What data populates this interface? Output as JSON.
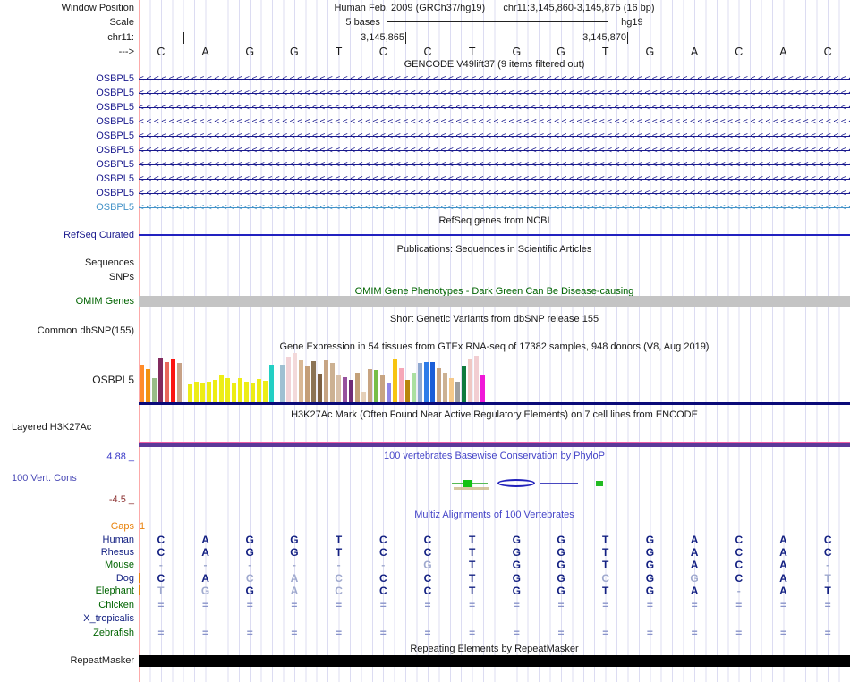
{
  "header": {
    "window_position_label": "Window Position",
    "assembly": "Human Feb. 2009 (GRCh37/hg19)",
    "position": "chr11:3,145,860-3,145,875 (16 bp)",
    "scale_label": "Scale",
    "scale_bases": "5 bases",
    "scale_assembly": "hg19",
    "chrom_label": "chr11:",
    "coord_left": "3,145,865",
    "coord_right": "3,145,870",
    "strand_label": "--->"
  },
  "base_track": {
    "bases": [
      "C",
      "A",
      "G",
      "G",
      "T",
      "C",
      "C",
      "T",
      "G",
      "G",
      "T",
      "G",
      "A",
      "C",
      "A",
      "C"
    ]
  },
  "gencode": {
    "title": "GENCODE V49lift37 (9 items filtered out)",
    "genes": [
      {
        "label": "OSBPL5",
        "color": "#1a1a8e"
      },
      {
        "label": "OSBPL5",
        "color": "#1a1a8e"
      },
      {
        "label": "OSBPL5",
        "color": "#1a1a8e"
      },
      {
        "label": "OSBPL5",
        "color": "#1a1a8e"
      },
      {
        "label": "OSBPL5",
        "color": "#1a1a8e"
      },
      {
        "label": "OSBPL5",
        "color": "#1a1a8e"
      },
      {
        "label": "OSBPL5",
        "color": "#1a1a8e"
      },
      {
        "label": "OSBPL5",
        "color": "#1a1a8e"
      },
      {
        "label": "OSBPL5",
        "color": "#1a1a8e"
      },
      {
        "label": "OSBPL5",
        "color": "#4493c8"
      }
    ]
  },
  "refseq": {
    "title": "RefSeq genes from NCBI",
    "label": "RefSeq Curated"
  },
  "publications": {
    "title": "Publications: Sequences in Scientific Articles",
    "sequences_label": "Sequences",
    "snps_label": "SNPs"
  },
  "omim": {
    "title": "OMIM Gene Phenotypes - Dark Green Can Be Disease-causing",
    "label": "OMIM Genes",
    "bar_color": "#c4c4c4"
  },
  "dbsnp": {
    "title": "Short Genetic Variants from dbSNP release 155",
    "label": "Common dbSNP(155)"
  },
  "gtex": {
    "title": "Gene Expression in 54 tissues from GTEx RNA-seq of 17382 samples, 948 donors (V8, Aug 2019)",
    "gene_label": "OSBPL5",
    "chart_data": {
      "type": "bar",
      "bars": [
        [
          "#FF8C2B",
          42
        ],
        [
          "#F2920F",
          37
        ],
        [
          "#99BD88",
          27
        ],
        [
          "#822B5F",
          49
        ],
        [
          "#E8685C",
          45
        ],
        [
          "#FB1410",
          48
        ],
        [
          "#C7A287",
          44
        ],
        [
          "#EDED16",
          20
        ],
        [
          "#EDED16",
          23
        ],
        [
          "#EDED16",
          22
        ],
        [
          "#EDED16",
          23
        ],
        [
          "#EDED16",
          25
        ],
        [
          "#EDED16",
          30
        ],
        [
          "#EDED16",
          27
        ],
        [
          "#EDED16",
          22
        ],
        [
          "#EDED16",
          27
        ],
        [
          "#EDED16",
          23
        ],
        [
          "#EDED16",
          21
        ],
        [
          "#EDED16",
          26
        ],
        [
          "#EDED16",
          24
        ],
        [
          "#23CFC4",
          42
        ],
        [
          "#9FC0D2",
          42
        ],
        [
          "#F2D2D6",
          51
        ],
        [
          "#F3D9DA",
          55
        ],
        [
          "#D9B895",
          47
        ],
        [
          "#C49E77",
          40
        ],
        [
          "#8B7355",
          46
        ],
        [
          "#7E6143",
          32
        ],
        [
          "#C7A584",
          47
        ],
        [
          "#CCB192",
          44
        ],
        [
          "#D8C0A8",
          30
        ],
        [
          "#96519E",
          28
        ],
        [
          "#6F2C77",
          25
        ],
        [
          "#C4A179",
          33
        ],
        [
          "#E5D0B9",
          12
        ],
        [
          "#C7A482",
          37
        ],
        [
          "#76BE48",
          36
        ],
        [
          "#C7A482",
          30
        ],
        [
          "#8F86E8",
          22
        ],
        [
          "#F7C411",
          48
        ],
        [
          "#F6A7B8",
          38
        ],
        [
          "#B8860B",
          25
        ],
        [
          "#ABE0A0",
          33
        ],
        [
          "#8FA8D0",
          44
        ],
        [
          "#2E7CE8",
          45
        ],
        [
          "#1B5ED8",
          45
        ],
        [
          "#C7A482",
          38
        ],
        [
          "#CCB192",
          33
        ],
        [
          "#F5C98A",
          27
        ],
        [
          "#9E9E9E",
          23
        ],
        [
          "#0F7A3D",
          40
        ],
        [
          "#EFC8C4",
          48
        ],
        [
          "#F2CED2",
          52
        ],
        [
          "#F018D8",
          30
        ]
      ]
    }
  },
  "h3k27ac": {
    "title": "H3K27Ac Mark (Often Found Near Active Regulatory Elements) on 7 cell lines from ENCODE",
    "label": "Layered H3K27Ac",
    "band_color": "#5c3999",
    "band_top_color": "#ee5fa5"
  },
  "conservation": {
    "title": "100 vertebrates Basewise Conservation by PhyloP",
    "label": "100 Vert. Cons",
    "max_label": "4.88 _",
    "min_label": "-4.5 _"
  },
  "multiz": {
    "title": "Multiz Alignments of 100 Vertebrates",
    "rows": [
      {
        "label": "Gaps",
        "label_color": "#e8820c",
        "marker": "1",
        "seq": "",
        "mask": ""
      },
      {
        "label": "Human",
        "label_color": "#132082",
        "seq": "CAGGTCCTGGTGACAC",
        "mask": "0000000000000000"
      },
      {
        "label": "Rhesus",
        "label_color": "#132082",
        "seq": "CAGGTCCTGGTGACAC",
        "mask": "0000000000000000"
      },
      {
        "label": "Mouse",
        "label_color": "#006400",
        "seq": "------GTGGTGACA-",
        "mask": "1111111000000001"
      },
      {
        "label": "Dog",
        "label_color": "#132082",
        "tick": true,
        "seq": "CACACCCTGGCGGCAT",
        "mask": "0011100000101001"
      },
      {
        "label": "Elephant",
        "label_color": "#006400",
        "tick": true,
        "seq": "TGGACCCTGGTGA-AT",
        "mask": "1101100000000100"
      },
      {
        "label": "Chicken",
        "label_color": "#006400",
        "seq": "================",
        "mask": "1111111111111111"
      },
      {
        "label": "X_tropicalis",
        "label_color": "#132082",
        "seq": "",
        "mask": ""
      },
      {
        "label": "Zebrafish",
        "label_color": "#006400",
        "seq": "================",
        "mask": "1111111111111111"
      }
    ]
  },
  "repeatmasker": {
    "title": "Repeating Elements by RepeatMasker",
    "label": "RepeatMasker",
    "bar_color": "#000000"
  }
}
